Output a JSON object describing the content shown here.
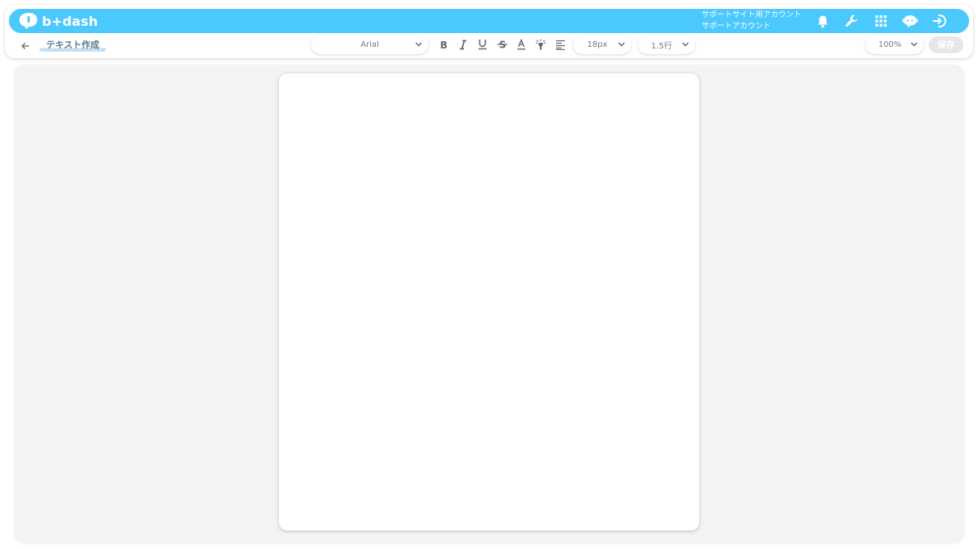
{
  "app": {
    "logo_text": "b+dash"
  },
  "header": {
    "account_line1": "サポートサイト用アカウント",
    "account_line2": "サポートアカウント",
    "icons": [
      "bell-icon",
      "wrench-icon",
      "apps-grid-icon",
      "chat-bubble-icon",
      "logout-icon"
    ]
  },
  "toolbar": {
    "title": "テキスト作成",
    "font_family": "Arial",
    "font_size": "18px",
    "line_height": "1.5行",
    "zoom": "100%",
    "save_label": "保存",
    "format_icons": [
      "bold-icon",
      "italic-icon",
      "underline-icon",
      "strikethrough-icon",
      "text-color-icon",
      "highlight-icon",
      "align-left-icon"
    ]
  },
  "colors": {
    "brand": "#4cc9fc",
    "title_text": "#5a7a8c",
    "save_disabled": "#e6e6e6",
    "canvas_bg": "#f3f3f3"
  }
}
